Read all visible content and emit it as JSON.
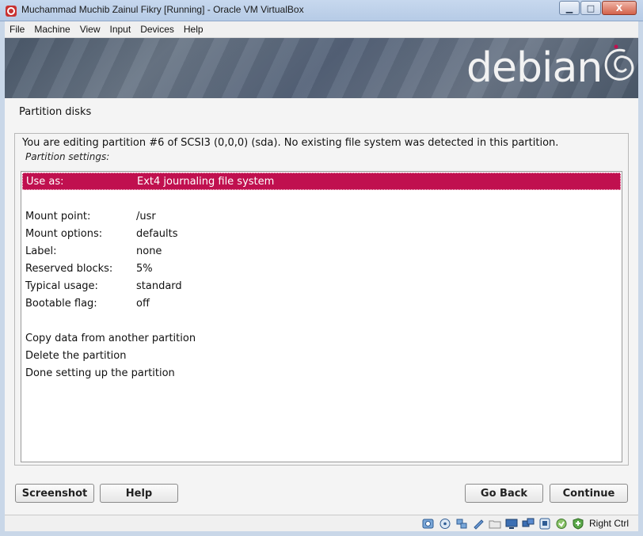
{
  "window": {
    "title": "Muchammad Muchib Zainul Fikry [Running] - Oracle VM VirtualBox",
    "buttons": {
      "minimize": "▁",
      "maximize": "□",
      "close": "X"
    }
  },
  "menubar": {
    "items": [
      {
        "label": "File"
      },
      {
        "label": "Machine"
      },
      {
        "label": "View"
      },
      {
        "label": "Input"
      },
      {
        "label": "Devices"
      },
      {
        "label": "Help"
      }
    ]
  },
  "banner": {
    "logo_text": "debian"
  },
  "installer": {
    "page_title": "Partition disks",
    "description": "You are editing partition #6 of SCSI3 (0,0,0) (sda). No existing file system was detected in this partition.",
    "subdescription": "Partition settings:",
    "rows": [
      {
        "key": "Use as:",
        "value": "Ext4 journaling file system",
        "selected": true
      },
      {
        "key": "",
        "value": ""
      },
      {
        "key": "Mount point:",
        "value": "/usr"
      },
      {
        "key": "Mount options:",
        "value": "defaults"
      },
      {
        "key": "Label:",
        "value": "none"
      },
      {
        "key": "Reserved blocks:",
        "value": "5%"
      },
      {
        "key": "Typical usage:",
        "value": "standard"
      },
      {
        "key": "Bootable flag:",
        "value": "off"
      },
      {
        "key": "",
        "value": ""
      },
      {
        "key": "Copy data from another partition",
        "value": ""
      },
      {
        "key": "Delete the partition",
        "value": ""
      },
      {
        "key": "Done setting up the partition",
        "value": ""
      }
    ],
    "buttons": {
      "screenshot": "Screenshot",
      "help": "Help",
      "go_back": "Go Back",
      "continue": "Continue"
    }
  },
  "statusbar": {
    "icons": [
      "hard-disk-icon",
      "optical-drive-icon",
      "usb-icon",
      "shared-folder-icon",
      "folder-icon",
      "display-icon",
      "network-icon",
      "capture-icon",
      "mouse-integration-icon",
      "keyboard-capture-icon"
    ],
    "host_key": "Right Ctrl"
  },
  "colors": {
    "selection": "#c0104f",
    "background": "#f4f4f4",
    "banner": "#56647a"
  }
}
